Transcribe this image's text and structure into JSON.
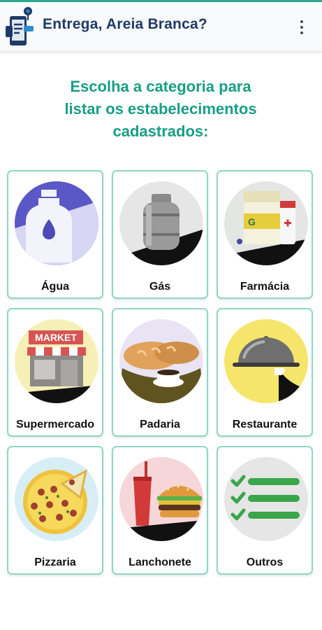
{
  "header": {
    "title": "Entrega, Areia Branca?"
  },
  "intro": {
    "lines": [
      "Escolha a categoria para",
      "listar os estabelecimentos",
      "cadastrados:"
    ]
  },
  "categories": [
    {
      "label": "Água",
      "icon": "water-bottle-icon"
    },
    {
      "label": "Gás",
      "icon": "gas-cylinder-icon"
    },
    {
      "label": "Farmácia",
      "icon": "pharmacy-icon"
    },
    {
      "label": "Supermercado",
      "icon": "market-icon"
    },
    {
      "label": "Padaria",
      "icon": "bread-icon"
    },
    {
      "label": "Restaurante",
      "icon": "cloche-icon"
    },
    {
      "label": "Pizzaria",
      "icon": "pizza-icon"
    },
    {
      "label": "Lanchonete",
      "icon": "burger-icon"
    },
    {
      "label": "Outros",
      "icon": "checklist-icon"
    }
  ],
  "illustration_text": {
    "market_sign": "MARKET"
  },
  "colors": {
    "accent": "#189e86",
    "title": "#1f3a66",
    "card_border": "#8fd6c5"
  }
}
